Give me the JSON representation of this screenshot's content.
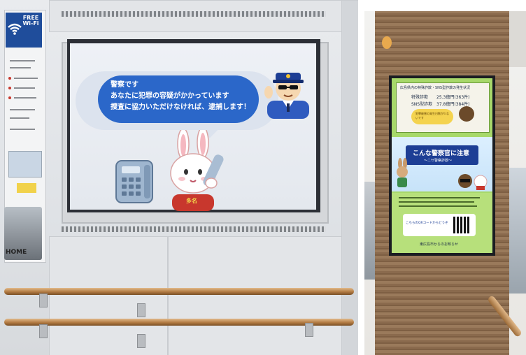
{
  "left_photo": {
    "wifi_sign": {
      "label": "FREE Wi-Fi"
    },
    "store_sign": {
      "label": "HOME"
    },
    "screen": {
      "speech_lines": [
        "警察です",
        "あなたに犯罪の容疑がかかっています",
        "捜査に協力いただけなければ、逮捕します！"
      ],
      "rabbit_shirt_text": "多名"
    }
  },
  "right_photo": {
    "kiosk": {
      "top_heading": "広島県内の特殊詐欺・SNS型詐欺の発生状況",
      "stats": [
        {
          "label": "特殊詐欺",
          "value": "25.3億円(363件)"
        },
        {
          "label": "SNS型詐欺",
          "value": "37.8億円(384件)"
        }
      ],
      "badge": "犯罪被害の発生日数が少ないです",
      "main_title": "こんな警察官に注意",
      "sub_title": "〜ニセ警察詐欺〜",
      "qr_label": "こちらのQRコードからどうぞ",
      "footer": "東広島市からのお知らせ"
    }
  },
  "colors": {
    "bubble_blue": "#2b67c9",
    "kiosk_green": "#a7d86a",
    "kiosk_title_navy": "#1d3e95",
    "rail_wood": "#b27b43"
  }
}
